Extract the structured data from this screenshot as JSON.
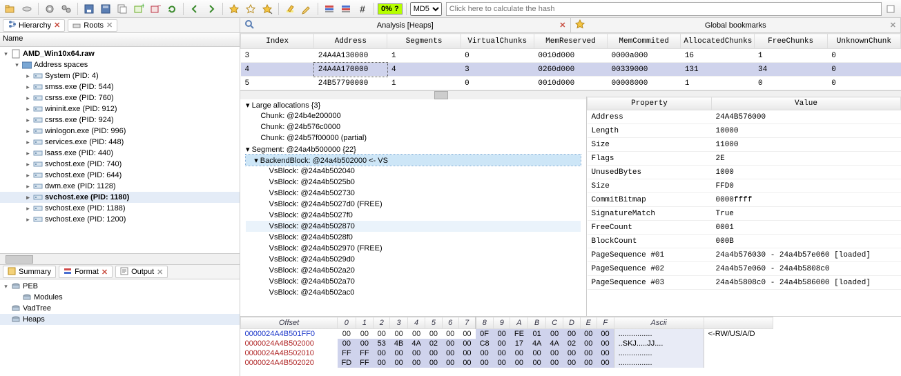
{
  "toolbar": {
    "percent": "0% ?",
    "hash_algo": "MD5",
    "hash_placeholder": "Click here to calculate the hash"
  },
  "left": {
    "tab_hierarchy": "Hierarchy",
    "tab_roots": "Roots",
    "header": "Name",
    "root": "AMD_Win10x64.raw",
    "addrspaces": "Address spaces",
    "procs": [
      "System (PID: 4)",
      "smss.exe (PID: 544)",
      "csrss.exe (PID: 760)",
      "wininit.exe (PID: 912)",
      "csrss.exe (PID: 924)",
      "winlogon.exe (PID: 996)",
      "services.exe (PID: 448)",
      "lsass.exe (PID: 440)",
      "svchost.exe (PID: 740)",
      "svchost.exe (PID: 644)",
      "dwm.exe (PID: 1128)",
      "svchost.exe (PID: 1180)",
      "svchost.exe (PID: 1188)",
      "svchost.exe (PID: 1200)"
    ],
    "selected_proc_index": 11,
    "lower_tabs": {
      "summary": "Summary",
      "format": "Format",
      "output": "Output"
    },
    "lower_tree": {
      "peb": "PEB",
      "modules": "Modules",
      "vadtree": "VadTree",
      "heaps": "Heaps"
    }
  },
  "right": {
    "tab_analysis": "Analysis [Heaps]",
    "tab_bookmarks": "Global bookmarks",
    "grid": {
      "columns": [
        "Index",
        "Address",
        "Segments",
        "VirtualChunks",
        "MemReserved",
        "MemCommited",
        "AllocatedChunks",
        "FreeChunks",
        "UnknownChunk"
      ],
      "rows": [
        [
          "3",
          "24A4A130000",
          "1",
          "0",
          "0010d000",
          "0000a000",
          "16",
          "1",
          "0"
        ],
        [
          "4",
          "24A4A170000",
          "4",
          "3",
          "0260d000",
          "00339000",
          "131",
          "34",
          "0"
        ],
        [
          "5",
          "24B57790000",
          "1",
          "0",
          "0010d000",
          "00008000",
          "1",
          "0",
          "0"
        ]
      ],
      "selected_row": 1
    },
    "alloc": {
      "lines": [
        {
          "indent": 0,
          "twist": "▾",
          "text": "Large allocations {3}"
        },
        {
          "indent": 1,
          "twist": "",
          "text": "Chunk: @24b4e200000"
        },
        {
          "indent": 1,
          "twist": "",
          "text": "Chunk: @24b576c0000"
        },
        {
          "indent": 1,
          "twist": "",
          "text": "Chunk: @24b57f00000 (partial)"
        },
        {
          "indent": 0,
          "twist": "▾",
          "text": "Segment: @24a4b500000 {22}"
        },
        {
          "indent": 1,
          "twist": "▾",
          "text": "BackendBlock: @24a4b502000 <- VS",
          "sel": true
        },
        {
          "indent": 2,
          "twist": "",
          "text": "VsBlock: @24a4b502040"
        },
        {
          "indent": 2,
          "twist": "",
          "text": "VsBlock: @24a4b5025b0"
        },
        {
          "indent": 2,
          "twist": "",
          "text": "VsBlock: @24a4b502730"
        },
        {
          "indent": 2,
          "twist": "",
          "text": "VsBlock: @24a4b5027d0 (FREE)"
        },
        {
          "indent": 2,
          "twist": "",
          "text": "VsBlock: @24a4b5027f0"
        },
        {
          "indent": 2,
          "twist": "",
          "text": "VsBlock: @24a4b502870",
          "hov": true
        },
        {
          "indent": 2,
          "twist": "",
          "text": "VsBlock: @24a4b5028f0"
        },
        {
          "indent": 2,
          "twist": "",
          "text": "VsBlock: @24a4b502970 (FREE)"
        },
        {
          "indent": 2,
          "twist": "",
          "text": "VsBlock: @24a4b5029d0"
        },
        {
          "indent": 2,
          "twist": "",
          "text": "VsBlock: @24a4b502a20"
        },
        {
          "indent": 2,
          "twist": "",
          "text": "VsBlock: @24a4b502a70"
        },
        {
          "indent": 2,
          "twist": "",
          "text": "VsBlock: @24a4b502ac0"
        }
      ]
    },
    "props": {
      "col1": "Property",
      "col2": "Value",
      "rows": [
        [
          "Address",
          "24A4B576000"
        ],
        [
          "Length",
          "10000"
        ],
        [
          "Size",
          "11000"
        ],
        [
          "Flags",
          "2E"
        ],
        [
          "UnusedBytes",
          "1000"
        ],
        [
          "Size",
          "FFD0"
        ],
        [
          "CommitBitmap",
          "0000ffff"
        ],
        [
          "SignatureMatch",
          "True"
        ],
        [
          "FreeCount",
          "0001"
        ],
        [
          "BlockCount",
          "000B"
        ],
        [
          "PageSequence #01",
          "24a4b576030 - 24a4b57e060 [loaded]"
        ],
        [
          "PageSequence #02",
          "24a4b57e060 - 24a4b5808c0"
        ],
        [
          "PageSequence #03",
          "24a4b5808c0 - 24a4b586000 [loaded]"
        ]
      ]
    },
    "hex": {
      "h_offset": "Offset",
      "h_ascii": "Ascii",
      "cols": [
        "0",
        "1",
        "2",
        "3",
        "4",
        "5",
        "6",
        "7",
        "8",
        "9",
        "A",
        "B",
        "C",
        "D",
        "E",
        "F"
      ],
      "rows": [
        {
          "off": "0000024A4B501FF0",
          "cls": "off0",
          "b": [
            "00",
            "00",
            "00",
            "00",
            "00",
            "00",
            "00",
            "00",
            "0F",
            "00",
            "FE",
            "01",
            "00",
            "00",
            "00",
            "00"
          ],
          "hi": [
            8,
            9,
            10,
            11,
            12,
            13,
            14,
            15
          ],
          "ascii": "................",
          "note": "<-RW/US/A/D"
        },
        {
          "off": "0000024A4B502000",
          "cls": "off1",
          "b": [
            "00",
            "00",
            "53",
            "4B",
            "4A",
            "02",
            "00",
            "00",
            "C8",
            "00",
            "17",
            "4A",
            "4A",
            "02",
            "00",
            "00"
          ],
          "hi": [
            0,
            1,
            2,
            3,
            4,
            5,
            6,
            7,
            8,
            9,
            10,
            11,
            12,
            13,
            14,
            15
          ],
          "ascii": "..SKJ.....JJ...."
        },
        {
          "off": "0000024A4B502010",
          "cls": "off1",
          "b": [
            "FF",
            "FF",
            "00",
            "00",
            "00",
            "00",
            "00",
            "00",
            "00",
            "00",
            "00",
            "00",
            "00",
            "00",
            "00",
            "00"
          ],
          "hi": [
            0,
            1,
            2,
            3,
            4,
            5,
            6,
            7,
            8,
            9,
            10,
            11,
            12,
            13,
            14,
            15
          ],
          "ascii": "................"
        },
        {
          "off": "0000024A4B502020",
          "cls": "off1",
          "b": [
            "FD",
            "FF",
            "00",
            "00",
            "00",
            "00",
            "00",
            "00",
            "00",
            "00",
            "00",
            "00",
            "00",
            "00",
            "00",
            "00"
          ],
          "hi": [
            0,
            1,
            2,
            3,
            4,
            5,
            6,
            7,
            8,
            9,
            10,
            11,
            12,
            13,
            14,
            15
          ],
          "ascii": "................"
        }
      ]
    }
  }
}
